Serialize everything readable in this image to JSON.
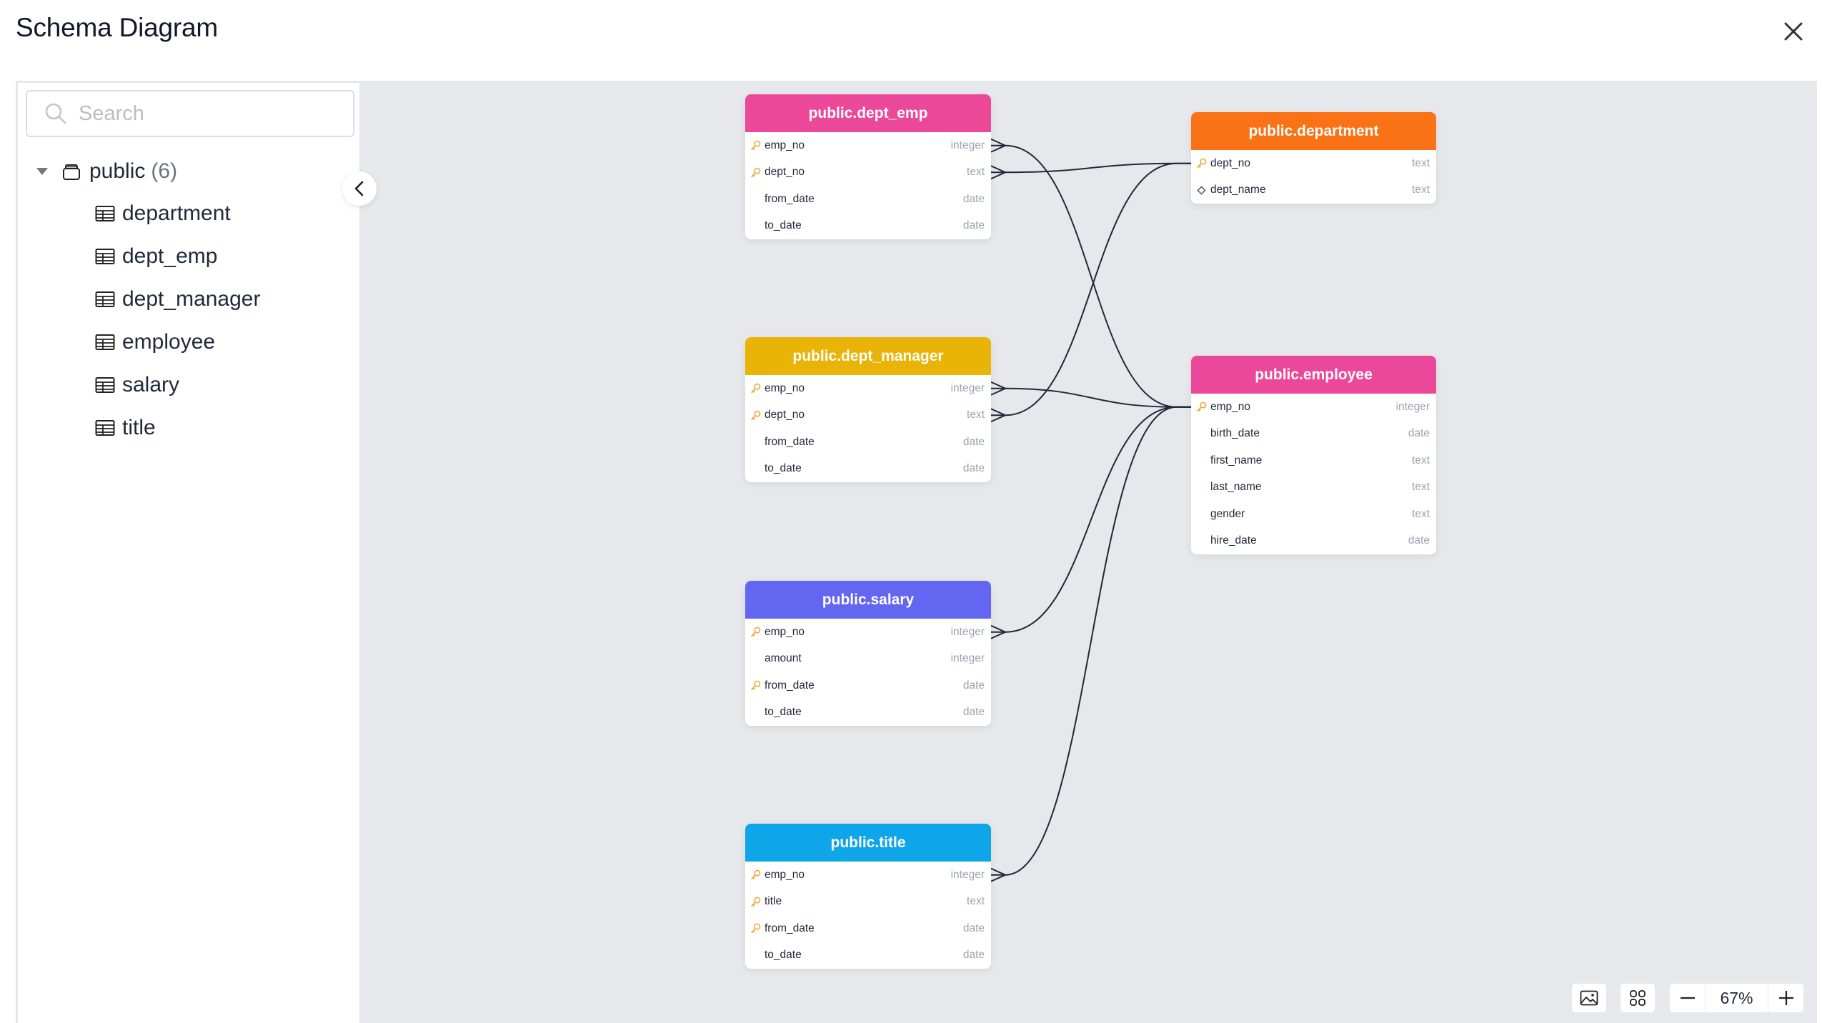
{
  "dialog": {
    "title": "Schema Diagram"
  },
  "sidebar": {
    "search_placeholder": "Search",
    "search_value": "",
    "schema": {
      "name": "public",
      "count_label": "(6)",
      "expanded": true
    },
    "items": [
      {
        "label": "department",
        "icon": "table-icon"
      },
      {
        "label": "dept_emp",
        "icon": "table-icon"
      },
      {
        "label": "dept_manager",
        "icon": "table-icon"
      },
      {
        "label": "employee",
        "icon": "table-icon"
      },
      {
        "label": "salary",
        "icon": "table-icon"
      },
      {
        "label": "title",
        "icon": "table-icon"
      }
    ]
  },
  "diagram": {
    "tables": [
      {
        "id": "dept_emp",
        "name": "public.dept_emp",
        "color": "#ec4899",
        "columns": [
          {
            "name": "emp_no",
            "type": "integer",
            "icon": "key"
          },
          {
            "name": "dept_no",
            "type": "text",
            "icon": "key"
          },
          {
            "name": "from_date",
            "type": "date",
            "icon": ""
          },
          {
            "name": "to_date",
            "type": "date",
            "icon": ""
          }
        ]
      },
      {
        "id": "department",
        "name": "public.department",
        "color": "#f97316",
        "columns": [
          {
            "name": "dept_no",
            "type": "text",
            "icon": "key"
          },
          {
            "name": "dept_name",
            "type": "text",
            "icon": "diamond"
          }
        ]
      },
      {
        "id": "dept_manager",
        "name": "public.dept_manager",
        "color": "#eab308",
        "columns": [
          {
            "name": "emp_no",
            "type": "integer",
            "icon": "key"
          },
          {
            "name": "dept_no",
            "type": "text",
            "icon": "key"
          },
          {
            "name": "from_date",
            "type": "date",
            "icon": ""
          },
          {
            "name": "to_date",
            "type": "date",
            "icon": ""
          }
        ]
      },
      {
        "id": "employee",
        "name": "public.employee",
        "color": "#ec4899",
        "columns": [
          {
            "name": "emp_no",
            "type": "integer",
            "icon": "key"
          },
          {
            "name": "birth_date",
            "type": "date",
            "icon": ""
          },
          {
            "name": "first_name",
            "type": "text",
            "icon": ""
          },
          {
            "name": "last_name",
            "type": "text",
            "icon": ""
          },
          {
            "name": "gender",
            "type": "text",
            "icon": ""
          },
          {
            "name": "hire_date",
            "type": "date",
            "icon": ""
          }
        ]
      },
      {
        "id": "salary",
        "name": "public.salary",
        "color": "#6366f1",
        "columns": [
          {
            "name": "emp_no",
            "type": "integer",
            "icon": "key"
          },
          {
            "name": "amount",
            "type": "integer",
            "icon": ""
          },
          {
            "name": "from_date",
            "type": "date",
            "icon": "key"
          },
          {
            "name": "to_date",
            "type": "date",
            "icon": ""
          }
        ]
      },
      {
        "id": "title",
        "name": "public.title",
        "color": "#0ea5e9",
        "columns": [
          {
            "name": "emp_no",
            "type": "integer",
            "icon": "key"
          },
          {
            "name": "title",
            "type": "text",
            "icon": "key"
          },
          {
            "name": "from_date",
            "type": "date",
            "icon": "key"
          },
          {
            "name": "to_date",
            "type": "date",
            "icon": ""
          }
        ]
      }
    ],
    "relations": [
      {
        "from_table": "dept_emp",
        "from_column": "emp_no",
        "to_table": "employee",
        "to_column": "emp_no"
      },
      {
        "from_table": "dept_emp",
        "from_column": "dept_no",
        "to_table": "department",
        "to_column": "dept_no"
      },
      {
        "from_table": "dept_manager",
        "from_column": "emp_no",
        "to_table": "employee",
        "to_column": "emp_no"
      },
      {
        "from_table": "dept_manager",
        "from_column": "dept_no",
        "to_table": "department",
        "to_column": "dept_no"
      },
      {
        "from_table": "salary",
        "from_column": "emp_no",
        "to_table": "employee",
        "to_column": "emp_no"
      },
      {
        "from_table": "title",
        "from_column": "emp_no",
        "to_table": "employee",
        "to_column": "emp_no"
      }
    ],
    "key_icon_color": "#f0a020",
    "edge_color": "#1f2937"
  },
  "toolbar": {
    "export_image_icon": "image-icon",
    "auto_layout_icon": "grid-icon",
    "zoom_out_icon": "minus-icon",
    "zoom_level": "67%",
    "zoom_in_icon": "plus-icon"
  }
}
